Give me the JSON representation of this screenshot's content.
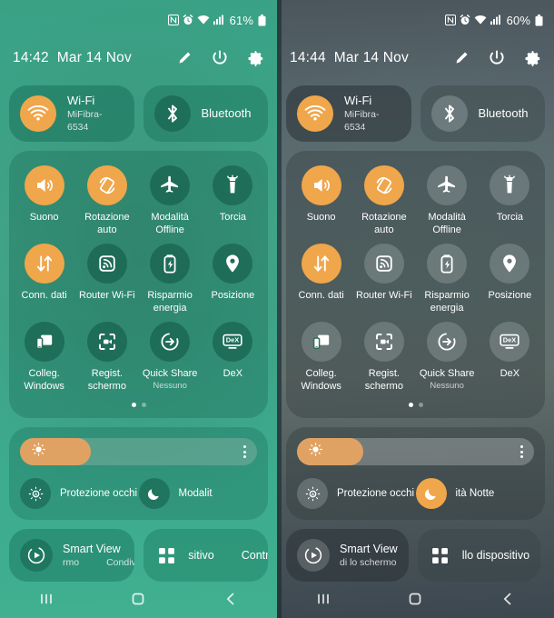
{
  "panels": [
    {
      "theme": "light",
      "statusbar": {
        "icons": [
          "nfc-icon",
          "alarm-icon",
          "wifi-icon",
          "signal-icon"
        ],
        "battery": "61%"
      },
      "header": {
        "time": "14:42",
        "date": "Mar 14 Nov",
        "actions": [
          "edit-pencil-icon",
          "power-icon",
          "settings-gear-icon"
        ]
      },
      "connections": [
        {
          "name": "wifi",
          "title": "Wi-Fi",
          "sub": "MiFibra-6534",
          "active": true
        },
        {
          "name": "bluetooth",
          "title": "Bluetooth",
          "sub": "",
          "active": false
        }
      ],
      "toggles": [
        {
          "icon": "volume-icon",
          "label": "Suono",
          "sub": "",
          "active": true
        },
        {
          "icon": "rotate-icon",
          "label": "Rotazione auto",
          "sub": "",
          "active": true
        },
        {
          "icon": "airplane-icon",
          "label": "Modalità Offline",
          "sub": "",
          "active": false
        },
        {
          "icon": "flashlight-icon",
          "label": "Torcia",
          "sub": "",
          "active": false
        },
        {
          "icon": "datasync-icon",
          "label": "Conn. dati",
          "sub": "",
          "active": true
        },
        {
          "icon": "hotspot-icon",
          "label": "Router Wi-Fi",
          "sub": "",
          "active": false
        },
        {
          "icon": "battery-saver-icon",
          "label": "Risparmio energia",
          "sub": "",
          "active": false
        },
        {
          "icon": "location-pin-icon",
          "label": "Posizione",
          "sub": "",
          "active": false
        },
        {
          "icon": "link-windows-icon",
          "label": "Colleg. Windows",
          "sub": "",
          "active": false
        },
        {
          "icon": "screen-record-icon",
          "label": "Regist. schermo",
          "sub": "",
          "active": false
        },
        {
          "icon": "quick-share-icon",
          "label": "Quick Share",
          "sub": "Nessuno",
          "active": false
        },
        {
          "icon": "dex-icon",
          "label": "DeX",
          "sub": "",
          "active": false
        }
      ],
      "pages": {
        "count": 2,
        "active": 0
      },
      "brightness": {
        "percent": 30
      },
      "brightness_items": [
        {
          "icon": "eye-comfort-icon",
          "label": "Protezione occhi",
          "active": false
        },
        {
          "icon": "moon-icon",
          "label": "Modalit",
          "active": false
        }
      ],
      "media": {
        "title": "Smart View",
        "sub_left": "rmo",
        "sub_right": "Condiv"
      },
      "devices": {
        "label_left": "sitivo",
        "label_right": "Contr"
      },
      "navbar": [
        "recents-icon",
        "home-icon",
        "back-icon"
      ]
    },
    {
      "theme": "dark",
      "statusbar": {
        "icons": [
          "nfc-icon",
          "alarm-icon",
          "wifi-icon",
          "signal-icon"
        ],
        "battery": "60%"
      },
      "header": {
        "time": "14:44",
        "date": "Mar 14 Nov",
        "actions": [
          "edit-pencil-icon",
          "power-icon",
          "settings-gear-icon"
        ]
      },
      "connections": [
        {
          "name": "wifi",
          "title": "Wi-Fi",
          "sub": "MiFibra-6534",
          "active": true
        },
        {
          "name": "bluetooth",
          "title": "Bluetooth",
          "sub": "",
          "active": false
        }
      ],
      "toggles": [
        {
          "icon": "volume-icon",
          "label": "Suono",
          "sub": "",
          "active": true
        },
        {
          "icon": "rotate-icon",
          "label": "Rotazione auto",
          "sub": "",
          "active": true
        },
        {
          "icon": "airplane-icon",
          "label": "Modalità Offline",
          "sub": "",
          "active": false
        },
        {
          "icon": "flashlight-icon",
          "label": "Torcia",
          "sub": "",
          "active": false
        },
        {
          "icon": "datasync-icon",
          "label": "Conn. dati",
          "sub": "",
          "active": true
        },
        {
          "icon": "hotspot-icon",
          "label": "Router Wi-Fi",
          "sub": "",
          "active": false
        },
        {
          "icon": "battery-saver-icon",
          "label": "Risparmio energia",
          "sub": "",
          "active": false
        },
        {
          "icon": "location-pin-icon",
          "label": "Posizione",
          "sub": "",
          "active": false
        },
        {
          "icon": "link-windows-icon",
          "label": "Colleg. Windows",
          "sub": "",
          "active": false
        },
        {
          "icon": "screen-record-icon",
          "label": "Regist. schermo",
          "sub": "",
          "active": false
        },
        {
          "icon": "quick-share-icon",
          "label": "Quick Share",
          "sub": "Nessuno",
          "active": false
        },
        {
          "icon": "dex-icon",
          "label": "DeX",
          "sub": "",
          "active": false
        }
      ],
      "pages": {
        "count": 2,
        "active": 0
      },
      "brightness": {
        "percent": 28
      },
      "brightness_items": [
        {
          "icon": "eye-comfort-icon",
          "label": "Protezione occhi",
          "active": false
        },
        {
          "icon": "moon-icon",
          "label": "ità Notte",
          "active": true
        }
      ],
      "media": {
        "title": "Smart View",
        "sub_left": "di lo schermo",
        "sub_right": ""
      },
      "devices": {
        "label_left": "llo dispositivo",
        "label_right": ""
      },
      "navbar": [
        "recents-icon",
        "home-icon",
        "back-icon"
      ]
    }
  ],
  "colors": {
    "accent": "#f0a64a",
    "slider_fill": "#e0a262",
    "left_bg": "#3fa98b",
    "right_bg": "#5d6d72"
  }
}
